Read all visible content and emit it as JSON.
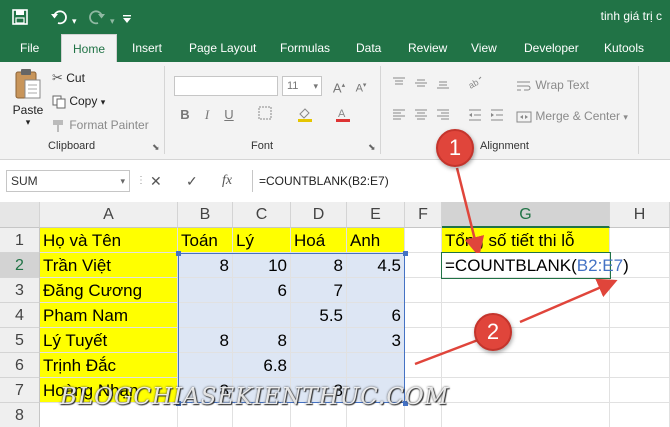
{
  "title_bar": {
    "doc_title": "tinh giá trị c",
    "qa_icons": [
      "save-icon",
      "undo-icon",
      "redo-icon",
      "customize-icon"
    ]
  },
  "tabs": [
    "File",
    "Home",
    "Insert",
    "Page Layout",
    "Formulas",
    "Data",
    "Review",
    "View",
    "Developer",
    "Kutools"
  ],
  "active_tab": "Home",
  "ribbon": {
    "clipboard": {
      "paste": "Paste",
      "cut": "Cut",
      "copy": "Copy",
      "format_painter": "Format Painter",
      "label": "Clipboard"
    },
    "font": {
      "size": "11",
      "bold": "B",
      "italic": "I",
      "underline": "U",
      "label": "Font"
    },
    "alignment": {
      "wrap_text": "Wrap Text",
      "merge_center": "Merge & Center",
      "label": "Alignment"
    }
  },
  "formula_bar": {
    "name_box": "SUM",
    "cancel": "✕",
    "enter": "✓",
    "fx": "fx",
    "formula": "=COUNTBLANK(B2:E7)"
  },
  "columns": [
    "A",
    "B",
    "C",
    "D",
    "E",
    "F",
    "G",
    "H"
  ],
  "rows": [
    "1",
    "2",
    "3",
    "4",
    "5",
    "6",
    "7",
    "8"
  ],
  "table": {
    "headers": [
      "Họ và Tên",
      "Toán",
      "Lý",
      "Hoá",
      "Anh"
    ],
    "data": [
      [
        "Trần Việt",
        "8",
        "10",
        "8",
        "4.5"
      ],
      [
        "Đăng Cương",
        "",
        "6",
        "7",
        ""
      ],
      [
        "Pham Nam",
        "",
        "",
        "5.5",
        "6"
      ],
      [
        "Lý Tuyết",
        "8",
        "8",
        "",
        "3"
      ],
      [
        "Trịnh Đắc",
        "",
        "6.8",
        "",
        ""
      ],
      [
        "Hoàng Nhạn",
        "8",
        "",
        "8",
        ""
      ]
    ]
  },
  "g_column": {
    "label": "Tổng số tiết thi lỗ",
    "formula_prefix": "=COUNTBLANK(",
    "formula_ref": "B2:E7",
    "formula_suffix": ")"
  },
  "callouts": {
    "one": "1",
    "two": "2"
  },
  "watermark": "BLOGCHIASEKIENTHUC.COM",
  "colors": {
    "excel_green": "#217346",
    "header_yellow": "#ffff00",
    "range_blue": "#4472c4",
    "callout_red": "#e0453b"
  }
}
